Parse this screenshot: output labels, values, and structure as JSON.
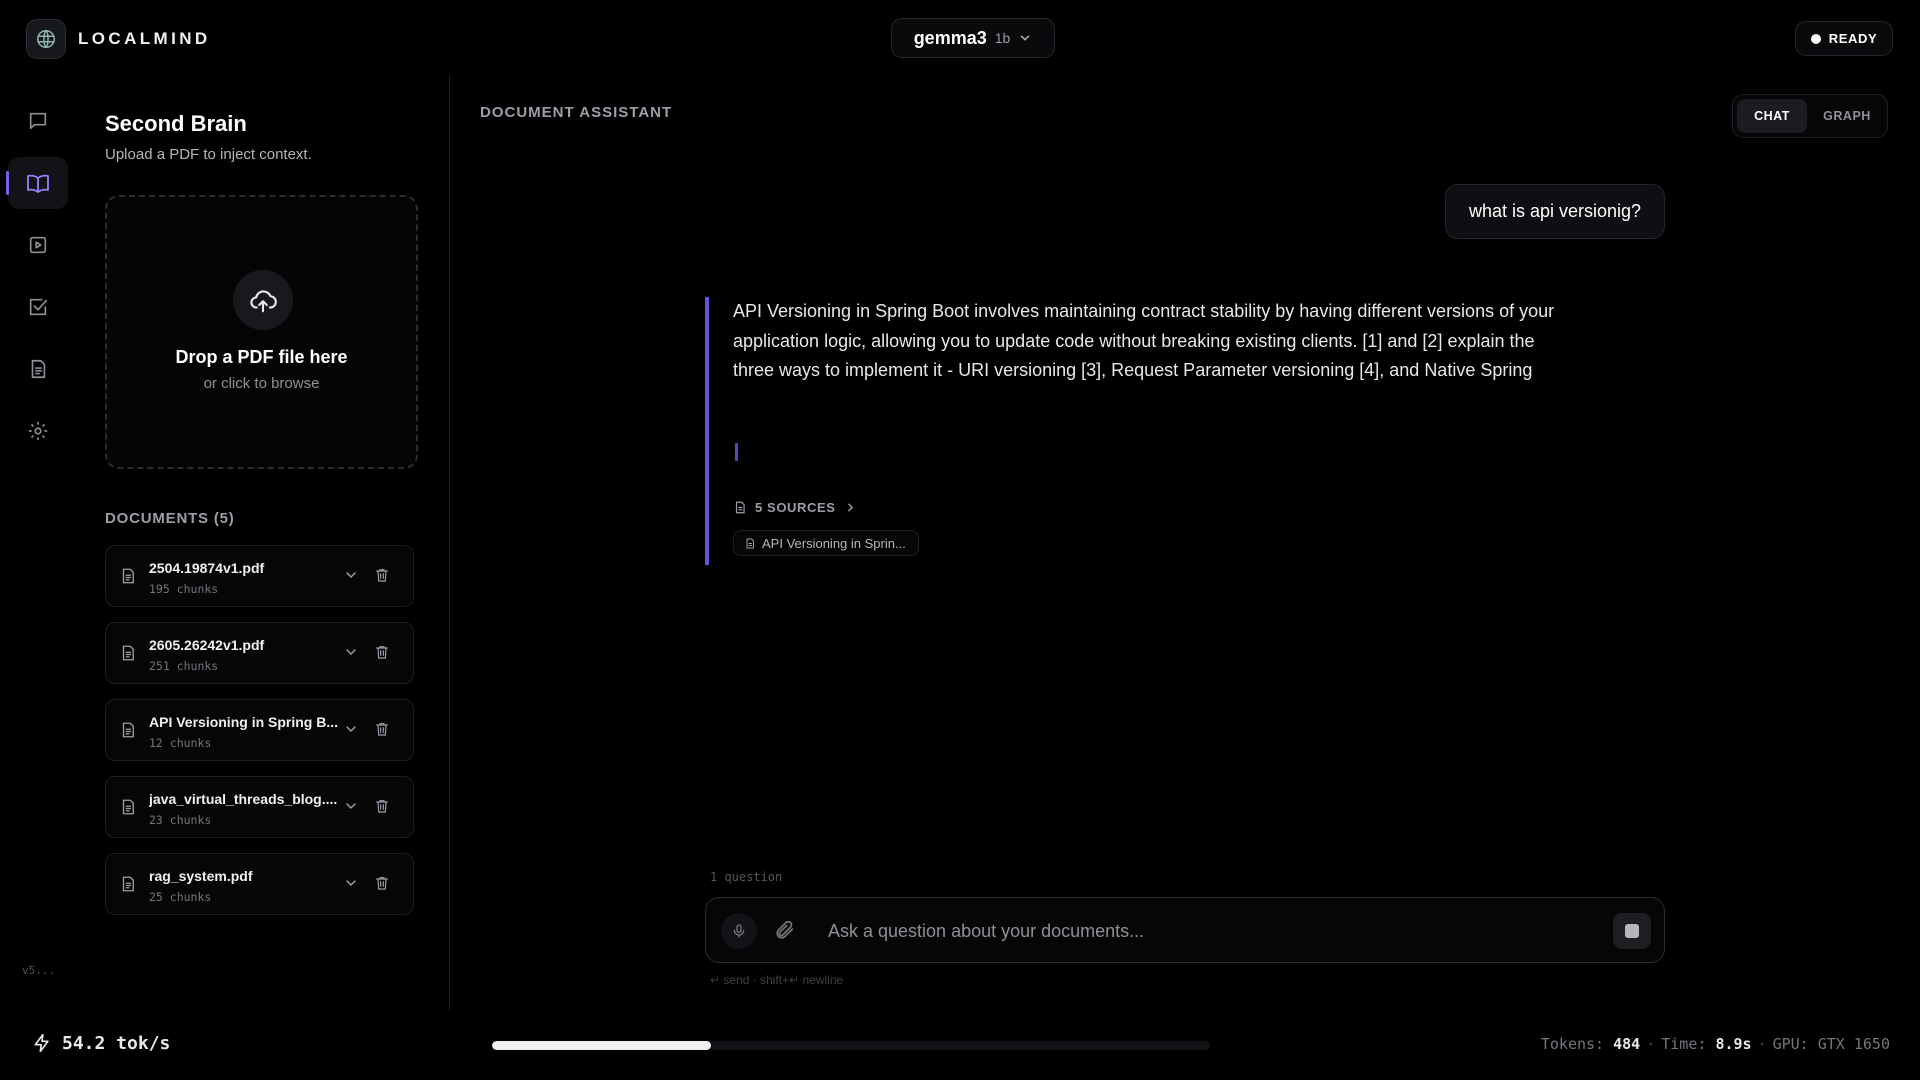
{
  "brand": {
    "name": "LOCALMIND",
    "icon": "brain-globe-icon"
  },
  "model": {
    "name": "gemma3",
    "size": "1b",
    "icon": "chevron-down-icon"
  },
  "status": {
    "label": "READY",
    "color": "#ffffff"
  },
  "nav": {
    "items": [
      {
        "icon": "chat-bubble-icon",
        "active": false
      },
      {
        "icon": "book-open-icon",
        "active": true
      },
      {
        "icon": "play-video-icon",
        "active": false
      },
      {
        "icon": "checkbox-icon",
        "active": false
      },
      {
        "icon": "document-icon",
        "active": false
      },
      {
        "icon": "gear-icon",
        "active": false
      }
    ],
    "version": "v5..."
  },
  "panel": {
    "title": "Second Brain",
    "subtitle": "Upload a PDF to inject context.",
    "dropzone": {
      "title": "Drop a PDF file here",
      "subtitle": "or click to browse",
      "icon": "cloud-upload-icon"
    },
    "documents_heading": "DOCUMENTS (5)",
    "documents": [
      {
        "name": "2504.19874v1.pdf",
        "chunks": "195 chunks"
      },
      {
        "name": "2605.26242v1.pdf",
        "chunks": "251 chunks"
      },
      {
        "name": "API Versioning in Spring B...",
        "chunks": "12 chunks"
      },
      {
        "name": "java_virtual_threads_blog....",
        "chunks": "23 chunks"
      },
      {
        "name": "rag_system.pdf",
        "chunks": "25 chunks"
      }
    ]
  },
  "main": {
    "heading": "DOCUMENT ASSISTANT",
    "tabs": [
      {
        "label": "CHAT",
        "active": true
      },
      {
        "label": "GRAPH",
        "active": false
      }
    ],
    "user_message": "what is api versionig?",
    "assistant_message": "API Versioning in Spring Boot involves maintaining contract stability by having different versions of your application logic, allowing you to update code without breaking existing clients. [1] and [2] explain the three ways to implement it - URI versioning [3], Request Parameter versioning [4], and Native Spring",
    "sources_label": "5 SOURCES",
    "source_chip": "API Versioning in Sprin...",
    "accent_color": "#6a4fd8",
    "question_count": "1 question",
    "composer": {
      "placeholder": "Ask a question about your documents...",
      "value": ""
    },
    "hint": "↵ send · shift+↵ newline"
  },
  "footer": {
    "speed": "54.2 tok/s",
    "progress": 0.305,
    "tokens_label": "Tokens:",
    "tokens_value": "484",
    "time_label": "Time:",
    "time_value": "8.9s",
    "gpu": "GPU: GTX 1650"
  }
}
